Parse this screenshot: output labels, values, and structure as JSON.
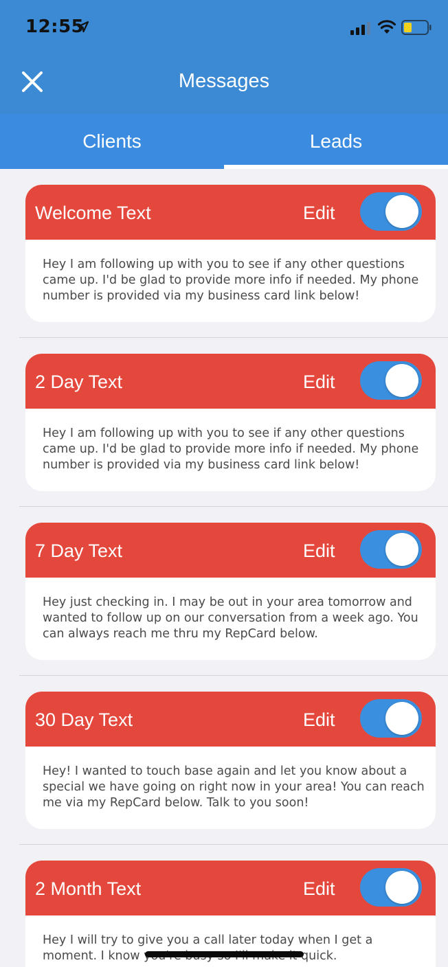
{
  "status_bar": {
    "time": "12:55",
    "icons": [
      "location-arrow-icon",
      "cellular-signal-icon",
      "wifi-icon",
      "battery-icon"
    ]
  },
  "nav": {
    "title": "Messages",
    "close_icon": "close-icon"
  },
  "tabs": [
    {
      "label": "Clients",
      "selected": false
    },
    {
      "label": "Leads",
      "selected": true
    }
  ],
  "messages": [
    {
      "title": "Welcome Text",
      "edit_label": "Edit",
      "enabled": true,
      "body": "Hey I am following up with you to see if any other questions came up. I'd be glad to provide more info if needed. My phone number is provided via my business card link below!"
    },
    {
      "title": "2 Day Text",
      "edit_label": "Edit",
      "enabled": true,
      "body": "Hey I am following up with you to see if any other questions came up. I'd be glad to provide more info if needed. My phone number is provided via my business card link below!"
    },
    {
      "title": "7 Day Text",
      "edit_label": "Edit",
      "enabled": true,
      "body": "Hey just checking in. I may be out in your area tomorrow and wanted to follow up on our conversation from a week ago. You can always reach me thru my RepCard below."
    },
    {
      "title": "30 Day Text",
      "edit_label": "Edit",
      "enabled": true,
      "body": "Hey! I wanted to touch base again and let you know about a special we have going on right now in your area! You can reach me via my RepCard below. Talk to you soon!"
    },
    {
      "title": "2 Month Text",
      "edit_label": "Edit",
      "enabled": true,
      "body": "Hey I will try to give you a call later today when I get a moment. I know you're busy so I'll make it quick."
    }
  ],
  "colors": {
    "header_blue": "#3c8ad3",
    "tab_blue": "#3b8ce0",
    "card_header_red": "#e4473b",
    "toggle_blue": "#3a8fde",
    "background": "#f1f1f6",
    "body_text": "#4a4a4a"
  }
}
